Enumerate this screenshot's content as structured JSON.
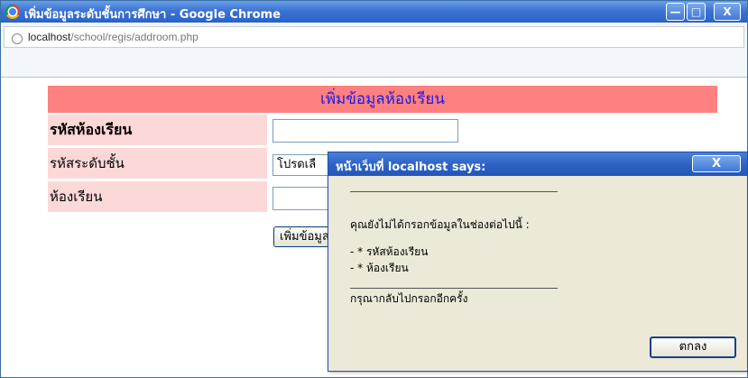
{
  "window": {
    "title": "เพิ่มข้อมูลระดับชั้นการศึกษา - Google Chrome",
    "minimize_glyph": "—",
    "maximize_glyph": "□",
    "close_glyph": "X"
  },
  "address": {
    "host": "localhost",
    "path": "/school/regis/addroom.php"
  },
  "form": {
    "header": "เพิ่มข้อมูลห้องเรียน",
    "fields": [
      {
        "label": "รหัสห้องเรียน",
        "value": ""
      },
      {
        "label": "รหัสระดับชั้น",
        "value": "โปรดเลื"
      },
      {
        "label": "ห้องเรียน",
        "value": ""
      }
    ],
    "submit_label": "เพิ่มข้อมูล"
  },
  "dialog": {
    "title": "หน้าเว็บที่ localhost says:",
    "close_glyph": "X",
    "message_intro": "คุณยังไม่ได้กรอกข้อมูลในช่องต่อไปนี้ :",
    "missing": [
      "- * รหัสห้องเรียน",
      "- * ห้องเรียน"
    ],
    "message_outro": "กรุณากลับไปกรอกอีกครั้ง",
    "ok_label": "ตกลง"
  }
}
